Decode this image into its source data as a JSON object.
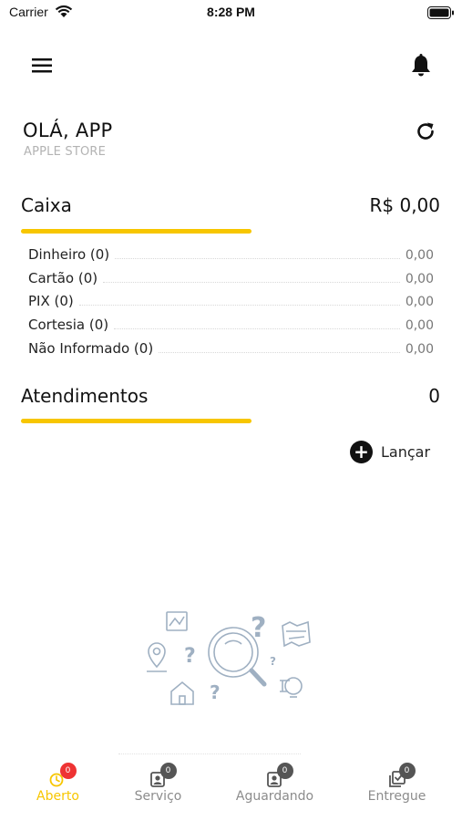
{
  "status_bar": {
    "carrier": "Carrier",
    "time": "8:28 PM"
  },
  "header": {
    "menu_icon": "hamburger-menu-icon",
    "notification_icon": "bell-icon"
  },
  "greeting": {
    "title": "OLÁ, APP",
    "store": "APPLE STORE",
    "refresh_icon": "refresh-icon"
  },
  "caixa": {
    "title": "Caixa",
    "total": "R$ 0,00",
    "rows": [
      {
        "label": "Dinheiro (0)",
        "value": "0,00"
      },
      {
        "label": "Cartão (0)",
        "value": "0,00"
      },
      {
        "label": "PIX (0)",
        "value": "0,00"
      },
      {
        "label": "Cortesia (0)",
        "value": "0,00"
      },
      {
        "label": "Não Informado (0)",
        "value": "0,00"
      }
    ]
  },
  "atendimentos": {
    "title": "Atendimentos",
    "count": "0",
    "launch_label": "Lançar"
  },
  "colors": {
    "accent": "#f7c600",
    "badge_active": "#ee3333",
    "badge": "#555555",
    "tab_inactive": "#8c8c8c"
  },
  "tabs": [
    {
      "label": "Aberto",
      "badge": "0",
      "icon": "clock-icon",
      "active": true
    },
    {
      "label": "Serviço",
      "badge": "0",
      "icon": "service-icon",
      "active": false
    },
    {
      "label": "Aguardando",
      "badge": "0",
      "icon": "waiting-icon",
      "active": false
    },
    {
      "label": "Entregue",
      "badge": "0",
      "icon": "delivered-icon",
      "active": false
    }
  ]
}
